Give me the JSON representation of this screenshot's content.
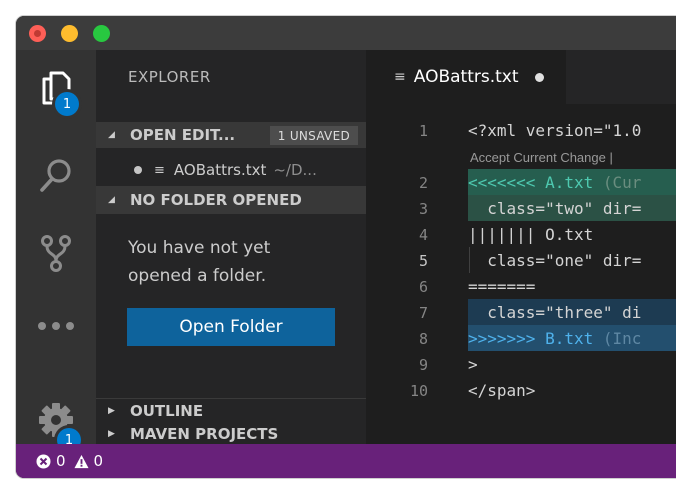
{
  "window": {
    "traffic_lights": {
      "close": "#fe5f57",
      "minimize": "#febc2e",
      "zoom": "#28c840"
    }
  },
  "activity_bar": {
    "explorer_badge": "1",
    "settings_badge": "1",
    "items": [
      "explorer-icon",
      "search-icon",
      "source-control-icon",
      "more-icon",
      "gear-icon"
    ]
  },
  "sidebar": {
    "title": "EXPLORER",
    "open_editors": {
      "label": "OPEN EDIT...",
      "badge": "1 UNSAVED"
    },
    "open_file": {
      "name": "AOBattrs.txt",
      "path": "~/D..."
    },
    "no_folder": {
      "label": "NO FOLDER OPENED"
    },
    "message": "You have not yet opened a folder.",
    "open_folder_button": "Open Folder",
    "outline": "OUTLINE",
    "maven": "MAVEN PROJECTS"
  },
  "editor": {
    "tab": {
      "label": "AOBattrs.txt"
    },
    "codelens": "Accept Current Change |",
    "lines": [
      {
        "num": "1",
        "text": "<?xml version=\"1.0"
      },
      {
        "num": "2",
        "marker": "<<<<<<< ",
        "text": "A.txt",
        "suffix": " (Cur"
      },
      {
        "num": "3",
        "text": "  class=\"two\" dir="
      },
      {
        "num": "4",
        "text": "||||||| O.txt"
      },
      {
        "num": "5",
        "text": "  class=\"one\" dir="
      },
      {
        "num": "6",
        "text": "======="
      },
      {
        "num": "7",
        "text": "  class=\"three\" di"
      },
      {
        "num": "8",
        "marker": ">>>>>>> ",
        "text": "B.txt",
        "suffix": " (Inc"
      },
      {
        "num": "9",
        "text": ">"
      },
      {
        "num": "10",
        "text": "</span>"
      }
    ],
    "colors": {
      "current_bg": "#2b5145",
      "incoming_bg": "#1d3b52"
    }
  },
  "status_bar": {
    "errors": "0",
    "warnings": "0",
    "color": "#68217a"
  }
}
